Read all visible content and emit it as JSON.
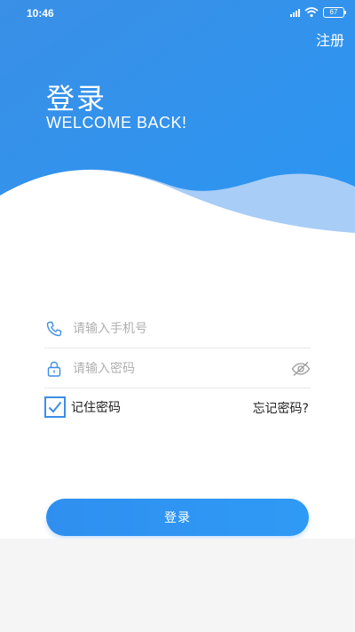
{
  "status_bar": {
    "time": "10:46",
    "battery": "67"
  },
  "header": {
    "register_label": "注册",
    "title": "登录",
    "subtitle": "WELCOME BACK!"
  },
  "form": {
    "phone_placeholder": "请输入手机号",
    "password_placeholder": "请输入密码",
    "remember_label": "记住密码",
    "remember_checked": true,
    "forgot_label": "忘记密码?",
    "login_label": "登录"
  },
  "colors": {
    "accent": "#2f8ff0",
    "hero_top": "#3a8fe6",
    "wave_light": "#a8cdf7"
  },
  "icons": [
    "phone-icon",
    "lock-icon",
    "eye-icon",
    "checkmark-icon",
    "wifi-icon",
    "signal-icon",
    "battery-icon"
  ]
}
